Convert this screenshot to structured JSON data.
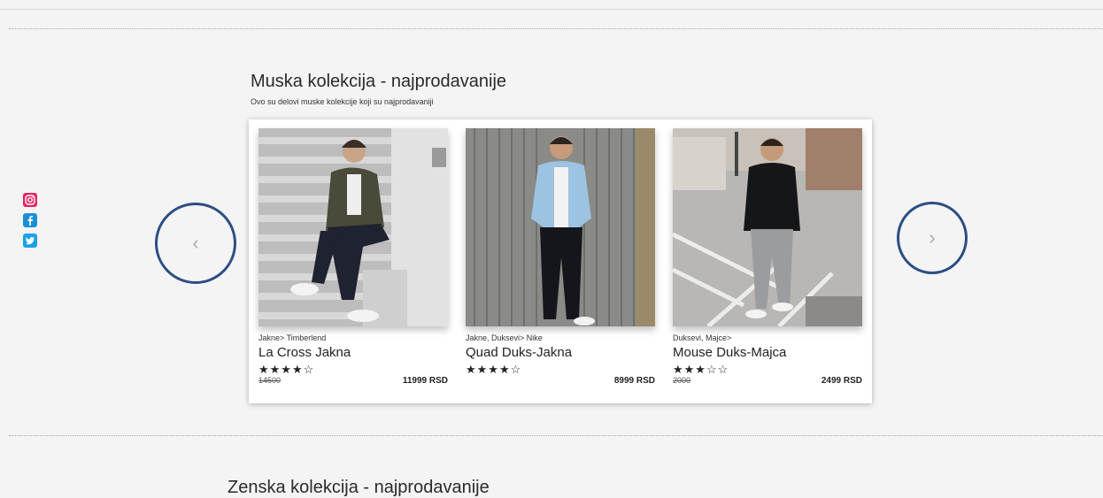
{
  "section1": {
    "title": "Muska kolekcija - najprodavanije",
    "subtitle": "Ovo su delovi muske kolekcije koji su najprodavaniji"
  },
  "section2": {
    "title": "Zenska kolekcija - najprodavanije"
  },
  "social_icons": [
    "instagram-icon",
    "facebook-icon",
    "twitter-icon"
  ],
  "carousel": {
    "prev_glyph": "‹",
    "next_glyph": "›",
    "products": [
      {
        "category": "Jakne> Timberlend",
        "name": "La Cross Jakna",
        "stars": "★★★★☆",
        "rating": 4,
        "old_price": "14500",
        "price": "11999 RSD"
      },
      {
        "category": "Jakne, Duksevi> Nike",
        "name": "Quad Duks-Jakna",
        "stars": "★★★★☆",
        "rating": 4,
        "old_price": "",
        "price": "8999 RSD"
      },
      {
        "category": "Duksevi, Majce>",
        "name": "Mouse Duks-Majca",
        "stars": "★★★☆☆",
        "rating": 3,
        "old_price": "2000",
        "price": "2499 RSD"
      }
    ]
  },
  "colors": {
    "arrow_ring": "#2c4e82",
    "instagram": "#e0245e",
    "facebook": "#1a8fd8",
    "twitter": "#1aa1e6"
  }
}
